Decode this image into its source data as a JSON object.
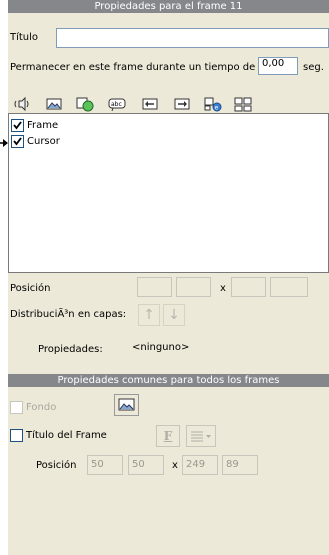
{
  "frame_panel": {
    "header": "Propiedades para el frame 11",
    "title_label": "Título",
    "title_value": "",
    "duration_label": "Permanecer en este frame durante un tiempo de",
    "duration_value": "0,00",
    "duration_unit": "seg.",
    "layers": [
      {
        "label": "Frame",
        "checked": true
      },
      {
        "label": "Cursor",
        "checked": true
      }
    ],
    "position_label": "Posición",
    "position_separator": "x",
    "distribution_label": "DistribuciÃ³n en capas:",
    "properties_label": "Propiedades:",
    "properties_value": "<ninguno>"
  },
  "common_panel": {
    "header": "Propiedades comunes para todos los frames",
    "background_label": "Fondo",
    "frame_title_label": "Título del Frame",
    "format_button": "F",
    "position_label": "Posición",
    "position_x": "50",
    "position_y": "50",
    "position_separator": "x",
    "width": "249",
    "height": "89"
  },
  "toolbar": {
    "icons": [
      "sound-icon",
      "image-icon",
      "shape-icon",
      "text-icon",
      "bring-forward-icon",
      "send-backward-icon",
      "web-object-icon",
      "group-icon"
    ]
  }
}
